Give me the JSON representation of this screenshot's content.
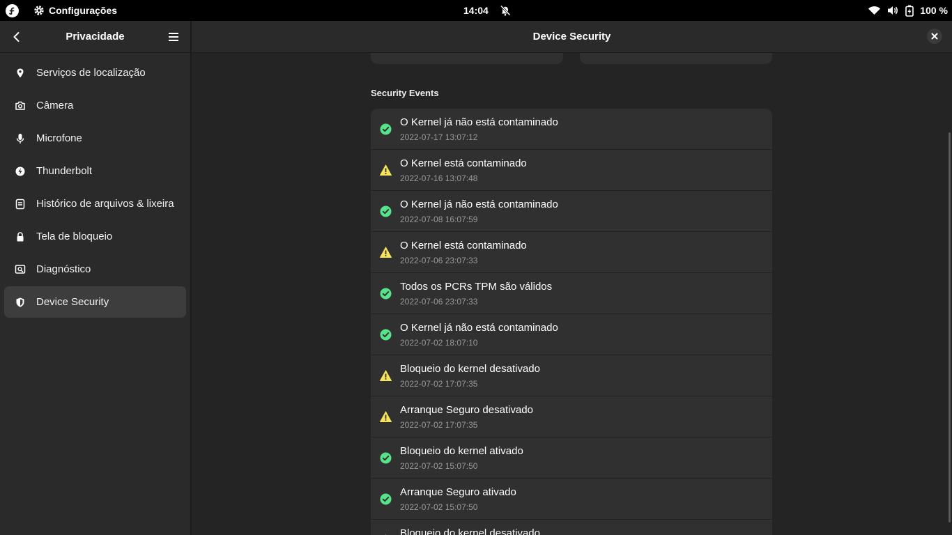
{
  "topbar": {
    "app_name": "Configurações",
    "clock": "14:04",
    "battery": "100 %"
  },
  "sidebar": {
    "title": "Privacidade",
    "items": [
      {
        "label": "Serviços de localização",
        "icon": "location-pin-icon"
      },
      {
        "label": "Câmera",
        "icon": "camera-icon"
      },
      {
        "label": "Microfone",
        "icon": "microphone-icon"
      },
      {
        "label": "Thunderbolt",
        "icon": "thunderbolt-icon"
      },
      {
        "label": "Histórico de arquivos & lixeira",
        "icon": "file-history-icon"
      },
      {
        "label": "Tela de bloqueio",
        "icon": "lock-icon"
      },
      {
        "label": "Diagnóstico",
        "icon": "diagnostics-icon"
      },
      {
        "label": "Device Security",
        "icon": "shield-icon",
        "active": true
      }
    ]
  },
  "main": {
    "title": "Device Security",
    "section_title": "Security Events",
    "events": [
      {
        "title": "O Kernel já não está contaminado",
        "date": "2022-07-17 13:07:12",
        "status": "ok"
      },
      {
        "title": "O Kernel está contaminado",
        "date": "2022-07-16 13:07:48",
        "status": "warning"
      },
      {
        "title": "O Kernel já não está contaminado",
        "date": "2022-07-08 16:07:59",
        "status": "ok"
      },
      {
        "title": "O Kernel está contaminado",
        "date": "2022-07-06 23:07:33",
        "status": "warning"
      },
      {
        "title": "Todos os PCRs TPM são válidos",
        "date": "2022-07-06 23:07:33",
        "status": "ok"
      },
      {
        "title": "O Kernel já não está contaminado",
        "date": "2022-07-02 18:07:10",
        "status": "ok"
      },
      {
        "title": "Bloqueio do kernel desativado",
        "date": "2022-07-02 17:07:35",
        "status": "warning"
      },
      {
        "title": "Arranque Seguro desativado",
        "date": "2022-07-02 17:07:35",
        "status": "warning"
      },
      {
        "title": "Bloqueio do kernel ativado",
        "date": "2022-07-02 15:07:50",
        "status": "ok"
      },
      {
        "title": "Arranque Seguro ativado",
        "date": "2022-07-02 15:07:50",
        "status": "ok"
      },
      {
        "title": "Bloqueio do kernel desativado",
        "date": "",
        "status": "warning"
      }
    ]
  },
  "colors": {
    "ok": "#57e389",
    "warning": "#f8e45c"
  }
}
